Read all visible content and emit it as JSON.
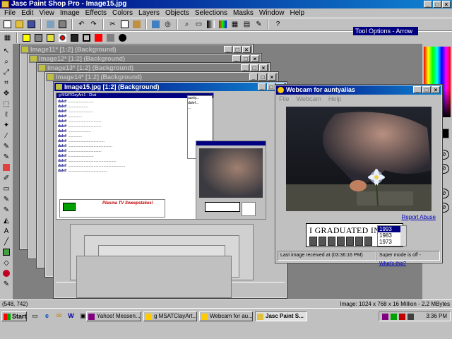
{
  "app": {
    "title": "Jasc Paint Shop Pro - Image15.jpg"
  },
  "menu": [
    "File",
    "Edit",
    "View",
    "Image",
    "Effects",
    "Colors",
    "Layers",
    "Objects",
    "Selections",
    "Masks",
    "Window",
    "Help"
  ],
  "tool_options": {
    "title": "Tool Options - Arrow"
  },
  "documents": [
    {
      "title": "Image11* [1:2] (Background)"
    },
    {
      "title": "Image12* [1:2] (Background)"
    },
    {
      "title": "Image13* [1:2] (Background)"
    },
    {
      "title": "Image14* [1:2] (Background)"
    },
    {
      "title": "Image15.jpg [1:2] (Background)"
    }
  ],
  "chat": {
    "title": "g MSATClayArt:1 - Chat",
    "users": [
      "aunty...",
      "dalef...",
      "..."
    ],
    "ad_title": "Plasma TV Sweepstakes!"
  },
  "webcam": {
    "title": "Webcam for auntyalias",
    "menu": [
      "File",
      "Webcam",
      "Help"
    ],
    "report_link": "Report Abuse",
    "ad": {
      "headline": "I GRADUATED IN:",
      "years": [
        "1993",
        "1983",
        "1973"
      ],
      "selected": "1993"
    },
    "status_left": "Last image received at (03:36:16 PM)",
    "status_right_prefix": "Super mode is off - ",
    "status_right_link": "What's this?"
  },
  "statusbar": {
    "coords": "(548, 742)",
    "image_info": "Image: 1024 x 768 x 16 Million - 2.2 MBytes"
  },
  "taskbar": {
    "start": "Start",
    "tasks": [
      {
        "label": "Yahoo! Messen...",
        "color": "#800080"
      },
      {
        "label": "g MSATClayArt...",
        "color": "#ffcc00"
      },
      {
        "label": "Webcam for au...",
        "color": "#ffcc00"
      },
      {
        "label": "Jasc Paint S...",
        "color": "#e0c040",
        "active": true
      }
    ],
    "clock": "3:36 PM"
  }
}
